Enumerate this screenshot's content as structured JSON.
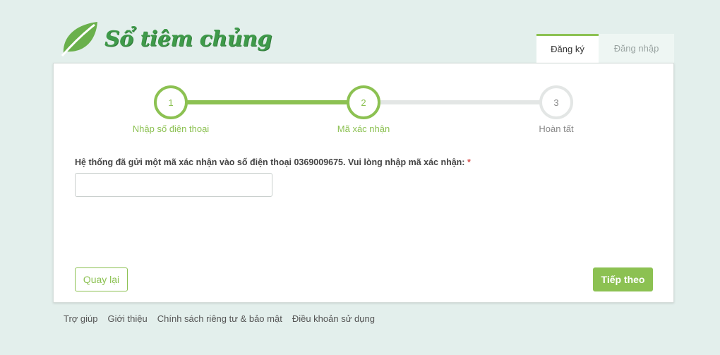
{
  "brand": {
    "name": "Sổ tiêm chủng",
    "logo_icon": "leaf-icon",
    "color": "#3f9a4a"
  },
  "tabs": [
    {
      "label": "Đăng ký",
      "active": true
    },
    {
      "label": "Đăng nhập",
      "active": false
    }
  ],
  "wizard": {
    "accent": "#8cc152",
    "current_step": 2,
    "steps": [
      {
        "number": "1",
        "label": "Nhập số điện thoại",
        "state": "done"
      },
      {
        "number": "2",
        "label": "Mã xác nhận",
        "state": "active"
      },
      {
        "number": "3",
        "label": "Hoàn tất",
        "state": "pending"
      }
    ]
  },
  "form": {
    "prompt": "Hệ thống đã gửi một mã xác nhận vào số điện thoại 0369009675. Vui lòng nhập mã xác nhận:",
    "required_mark": "*",
    "code_value": ""
  },
  "actions": {
    "back_label": "Quay lại",
    "next_label": "Tiếp theo"
  },
  "footer": {
    "links": [
      "Trợ giúp",
      "Giới thiệu",
      "Chính sách riêng tư & bảo mật",
      "Điều khoản sử dụng"
    ]
  }
}
